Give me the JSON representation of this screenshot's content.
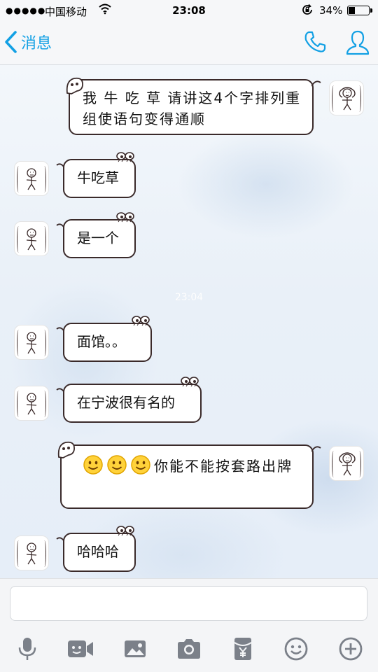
{
  "status_bar": {
    "signal": "●●●●●",
    "carrier": "中国移动",
    "time": "23:08",
    "battery": "34%",
    "battery_level": 0.34
  },
  "nav": {
    "back_label": "消息"
  },
  "colors": {
    "accent": "#12a0e4",
    "bubble_border": "#3a2a2a"
  },
  "timestamp": "23:04",
  "messages": [
    {
      "side": "right",
      "text": "我 牛 吃 草 请讲这4个字排列重组使语句变得通顺"
    },
    {
      "side": "left",
      "text": "牛吃草"
    },
    {
      "side": "left",
      "text": "是一个"
    },
    {
      "side": "left",
      "text": "面馆。。"
    },
    {
      "side": "left",
      "text": "在宁波很有名的"
    },
    {
      "side": "right",
      "emoji_count": 3,
      "text": "你能不能按套路出牌"
    },
    {
      "side": "left",
      "text": "哈哈哈"
    }
  ],
  "input": {
    "value": "",
    "placeholder": ""
  },
  "toolbar": [
    "mic-icon",
    "video-icon",
    "image-icon",
    "camera-icon",
    "red-packet-icon",
    "emoji-icon",
    "plus-icon"
  ]
}
